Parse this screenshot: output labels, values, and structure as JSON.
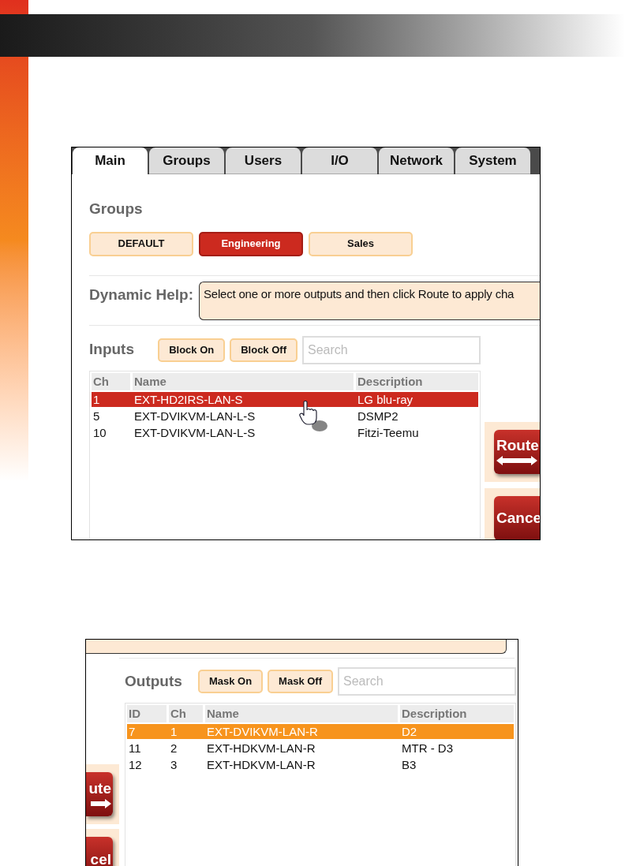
{
  "screenshot_top": {
    "tabs": [
      {
        "label": "Main",
        "selected": true
      },
      {
        "label": "Groups",
        "selected": false
      },
      {
        "label": "Users",
        "selected": false
      },
      {
        "label": "I/O",
        "selected": false
      },
      {
        "label": "Network",
        "selected": false
      },
      {
        "label": "System",
        "selected": false
      }
    ],
    "groups_heading": "Groups",
    "group_buttons": [
      {
        "label": "DEFAULT",
        "selected": false
      },
      {
        "label": "Engineering",
        "selected": true
      },
      {
        "label": "Sales",
        "selected": false
      }
    ],
    "dynamic_help": {
      "label": "Dynamic Help:",
      "text": "Select one or more outputs and then click Route to apply cha"
    },
    "inputs": {
      "label": "Inputs",
      "buttons": [
        "Block On",
        "Block Off"
      ],
      "search": {
        "placeholder": "Search"
      },
      "columns": [
        "Ch",
        "Name",
        "Description"
      ],
      "rows": [
        {
          "cells": [
            "1",
            "EXT-HD2IRS-LAN-S",
            "LG blu-ray"
          ],
          "selected": true
        },
        {
          "cells": [
            "5",
            "EXT-DVIKVM-LAN-L-S",
            "DSMP2"
          ],
          "selected": false
        },
        {
          "cells": [
            "10",
            "EXT-DVIKVM-LAN-L-S",
            "Fitzi-Teemu"
          ],
          "selected": false
        }
      ]
    },
    "side_buttons": [
      {
        "label": "Route",
        "kind": "route"
      },
      {
        "label": "Cance",
        "kind": "cancel"
      }
    ]
  },
  "screenshot_bottom": {
    "outputs": {
      "label": "Outputs",
      "buttons": [
        "Mask On",
        "Mask Off"
      ],
      "search": {
        "placeholder": "Search"
      },
      "columns": [
        "ID",
        "Ch",
        "Name",
        "Description"
      ],
      "rows": [
        {
          "cells": [
            "7",
            "1",
            "EXT-DVIKVM-LAN-R",
            "D2"
          ],
          "selected": true
        },
        {
          "cells": [
            "11",
            "2",
            "EXT-HDKVM-LAN-R",
            "MTR - D3"
          ],
          "selected": false
        },
        {
          "cells": [
            "12",
            "3",
            "EXT-HDKVM-LAN-R",
            "B3"
          ],
          "selected": false
        }
      ]
    },
    "side_buttons": [
      {
        "label": "ute",
        "kind": "route"
      },
      {
        "label": "cel",
        "kind": "cancel"
      }
    ]
  }
}
